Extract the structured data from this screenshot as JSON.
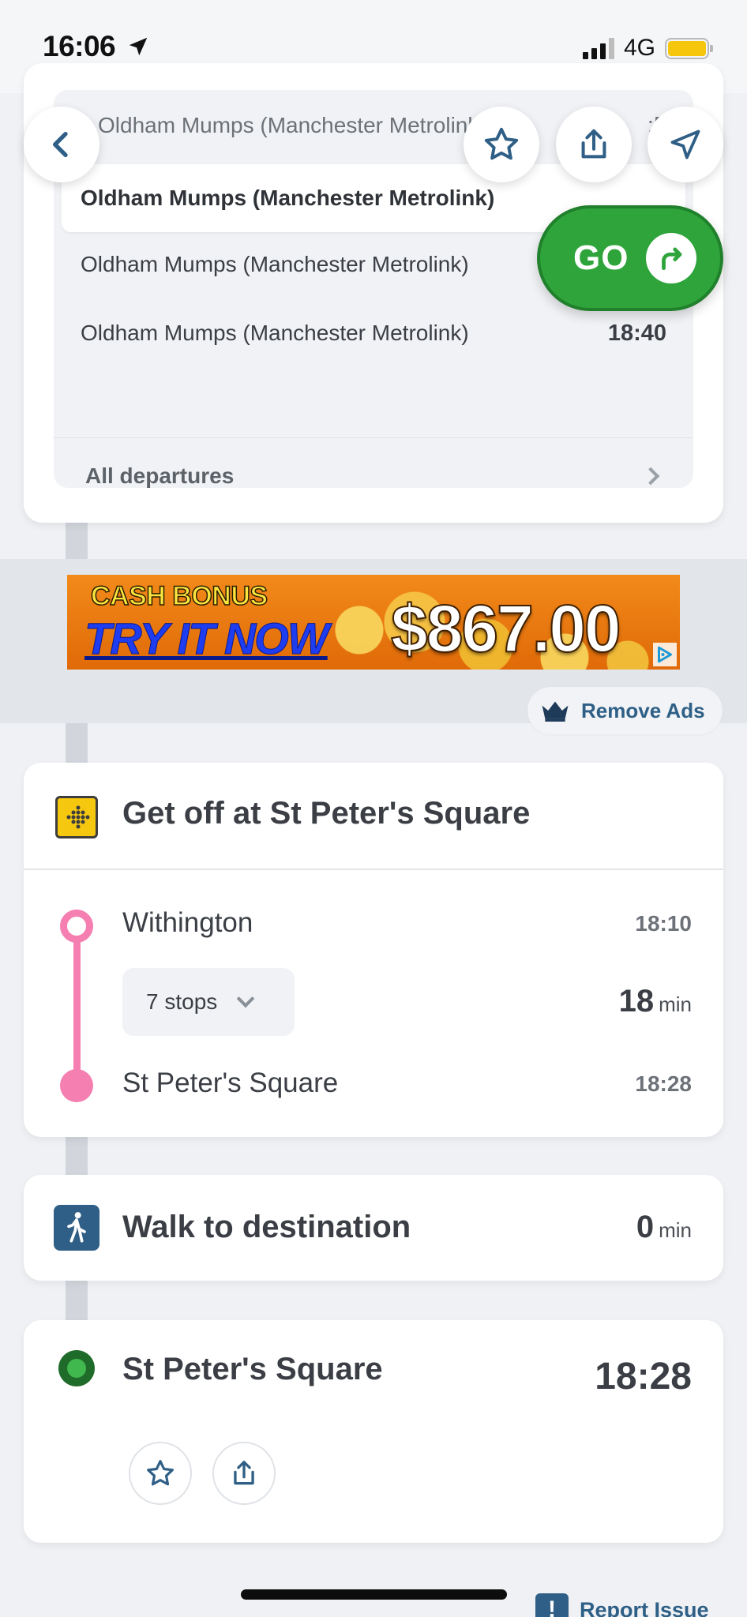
{
  "status_bar": {
    "time": "16:06",
    "network": "4G",
    "icons": [
      "location-arrow-icon",
      "signal-icon",
      "battery-icon"
    ]
  },
  "departures": {
    "partial_row": {
      "name": "Oldham Mumps (Manchester Metrolink)",
      "time": ":5"
    },
    "rows": [
      {
        "name": "Oldham Mumps (Manchester Metrolink)",
        "time": ""
      },
      {
        "name": "Oldham Mumps (Manchester Metrolink)",
        "time": ""
      },
      {
        "name": "Oldham Mumps (Manchester Metrolink)",
        "time": "18:40"
      }
    ],
    "all_label": "All departures"
  },
  "actions": {
    "back_icon": "chevron-left-icon",
    "favorite_icon": "star-icon",
    "share_icon": "share-icon",
    "navigate_icon": "navigation-arrow-icon",
    "go_label": "GO",
    "go_icon": "turn-right-arrow-icon"
  },
  "ad": {
    "headline": "CASH BONUS",
    "cta": "TRY IT NOW",
    "amount": "$867.00",
    "remove_ads_label": "Remove Ads"
  },
  "leg": {
    "title": "Get off at St Peter's Square",
    "from": {
      "name": "Withington",
      "time": "18:10"
    },
    "stops_label": "7 stops",
    "duration_value": "18",
    "duration_unit": "min",
    "to": {
      "name": "St Peter's Square",
      "time": "18:28"
    },
    "colors": {
      "line": "#f47fb0",
      "tram_icon": "#f5c80f"
    }
  },
  "walk": {
    "title": "Walk to destination",
    "duration_value": "0",
    "duration_unit": "min"
  },
  "destination": {
    "name": "St Peter's Square",
    "time": "18:28"
  },
  "footer": {
    "report_label": "Report Issue"
  },
  "colors": {
    "go_green": "#2ea43b",
    "accent_blue": "#2f5f86",
    "background": "#eff1f4"
  }
}
